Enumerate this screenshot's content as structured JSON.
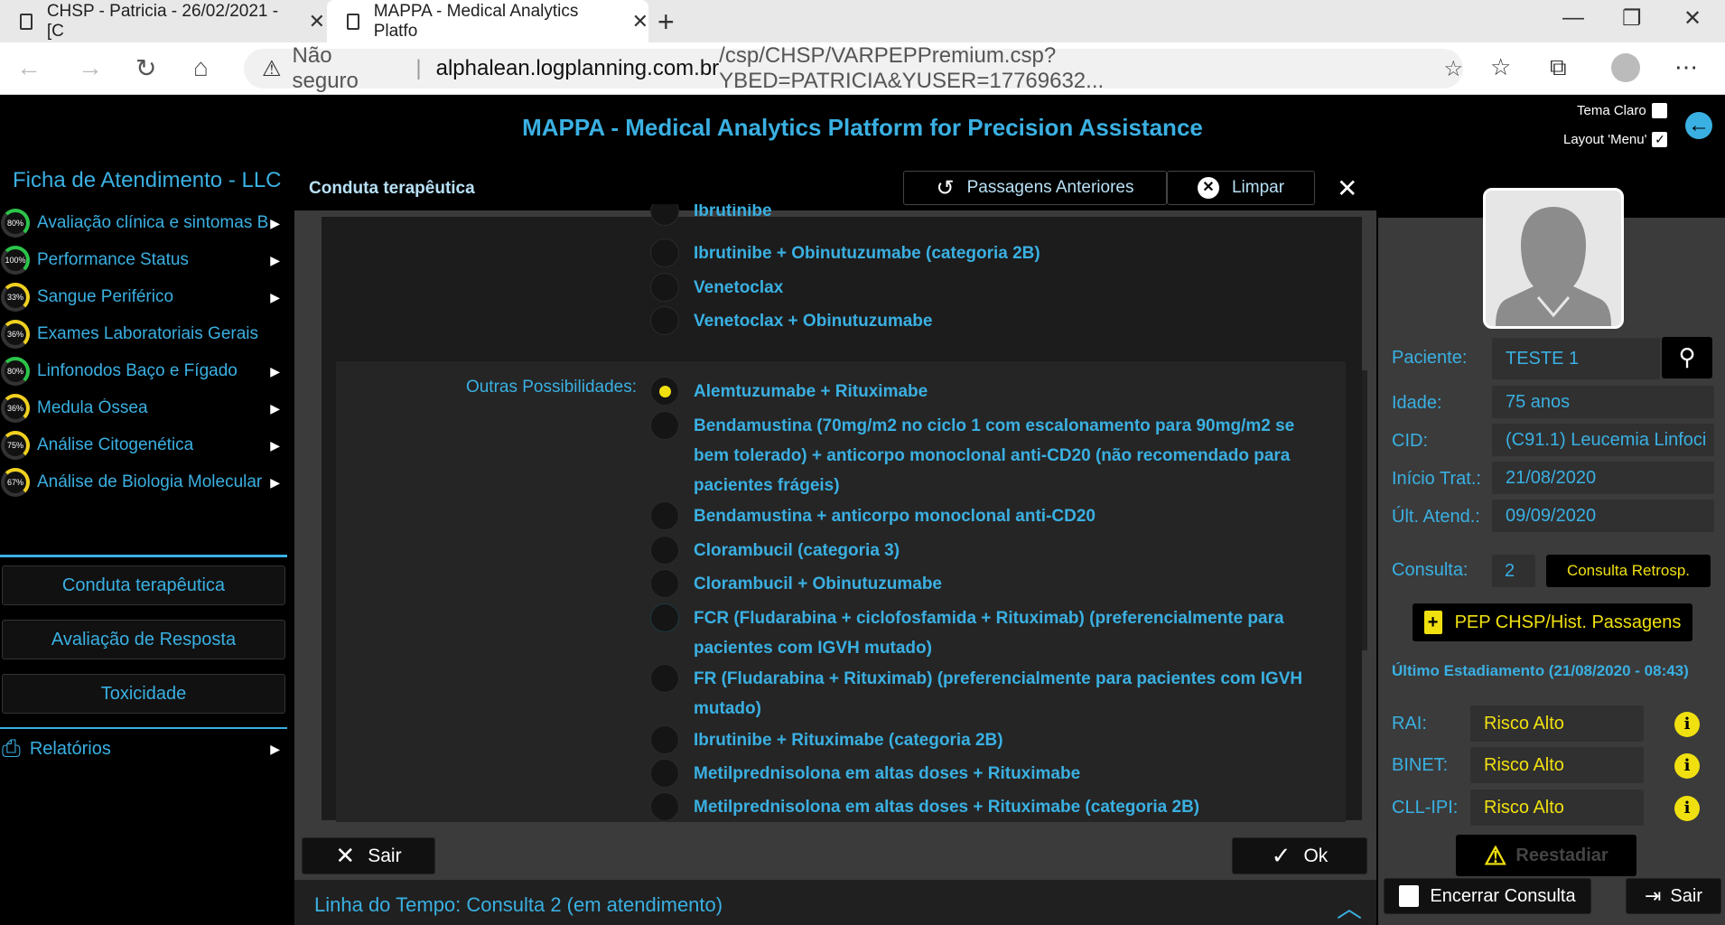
{
  "browser": {
    "tabs": [
      {
        "title": "CHSP - Patricia - 26/02/2021 - [C"
      },
      {
        "title": "MAPPA - Medical Analytics Platfo"
      }
    ],
    "address": {
      "warning": "Não seguro",
      "domain": "alphalean.logplanning.com.br",
      "path": "/csp/CHSP/VARPEPPremium.csp?YBED=PATRICIA&YUSER=17769632..."
    }
  },
  "app": {
    "title": "MAPPA - Medical Analytics Platform for Precision Assistance",
    "theme_label": "Tema Claro",
    "theme_checked": false,
    "layout_label": "Layout 'Menu'",
    "layout_checked": true
  },
  "sidebar": {
    "title": "Ficha de Atendimento - LLC",
    "items": [
      {
        "label": "Avaliação clínica e sintomas B",
        "progress": "80%"
      },
      {
        "label": "Performance Status",
        "progress": "100%"
      },
      {
        "label": "Sangue Periférico",
        "progress": "33%"
      },
      {
        "label": "Exames Laboratoriais Gerais",
        "progress": "36%"
      },
      {
        "label": "Linfonodos Baço e Fígado",
        "progress": "80%"
      },
      {
        "label": "Medula Óssea",
        "progress": "36%"
      },
      {
        "label": "Análise Citogenética",
        "progress": "75%"
      },
      {
        "label": "Análise de Biologia Molecular",
        "progress": "67%"
      }
    ],
    "buttons": [
      "Conduta terapêutica",
      "Avaliação de Resposta",
      "Toxicidade"
    ],
    "reports": "Relatórios"
  },
  "modal": {
    "title": "Conduta terapêutica",
    "prev_label": "Passagens Anteriores",
    "clear_label": "Limpar",
    "first_options": [
      "Ibrutinibe",
      "Ibrutinibe + Obinutuzumabe (categoria 2B)",
      "Venetoclax",
      "Venetoclax + Obinutuzumabe"
    ],
    "other_label": "Outras Possibilidades:",
    "other_options": [
      "Alemtuzumabe + Rituximabe",
      "Bendamustina (70mg/m2 no ciclo 1 com escalonamento para 90mg/m2 se bem tolerado) + anticorpo monoclonal anti-CD20 (não recomendado para pacientes frágeis)",
      "Bendamustina + anticorpo monoclonal anti-CD20",
      "Clorambucil (categoria 3)",
      "Clorambucil + Obinutuzumabe",
      "FCR (Fludarabina + ciclofosfamida + Rituximab) (preferencialmente para pacientes com IGVH mutado)",
      "FR (Fludarabina + Rituximab) (preferencialmente para pacientes com IGVH mutado)",
      "Ibrutinibe + Rituximabe (categoria 2B)",
      "Metilprednisolona em altas doses + Rituximabe",
      "Metilprednisolona em altas doses + Rituximabe (categoria 2B)"
    ],
    "selected_option": "Alemtuzumabe + Rituximabe",
    "sair_label": "Sair",
    "ok_label": "Ok"
  },
  "timeline": "Linha do Tempo: Consulta 2 (em atendimento)",
  "patient": {
    "paciente_label": "Paciente:",
    "paciente": "TESTE 1",
    "idade_label": "Idade:",
    "idade": "75 anos",
    "cid_label": "CID:",
    "cid": "(C91.1) Leucemia Linfoci",
    "inicio_label": "Início Trat.:",
    "inicio": "21/08/2020",
    "ult_label": "Últ. Atend.:",
    "ult": "09/09/2020",
    "consulta_label": "Consulta:",
    "consulta": "2",
    "retro_label": "Consulta Retrosp.",
    "pep_label": "PEP CHSP/Hist. Passagens",
    "estadiamento": "Último Estadiamento (21/08/2020 - 08:43)",
    "rai_label": "RAI:",
    "rai": "Risco Alto",
    "binet_label": "BINET:",
    "binet": "Risco Alto",
    "cllipi_label": "CLL-IPI:",
    "cllipi": "Risco Alto",
    "reestadiar_label": "Reestadiar",
    "encerrar_label": "Encerrar Consulta",
    "sair_label": "Sair"
  },
  "colors": {
    "accent": "#3ab0e2",
    "highlight": "#f0e010",
    "ok_gauge": "#2bc44a",
    "warn_gauge": "#f0d020"
  }
}
